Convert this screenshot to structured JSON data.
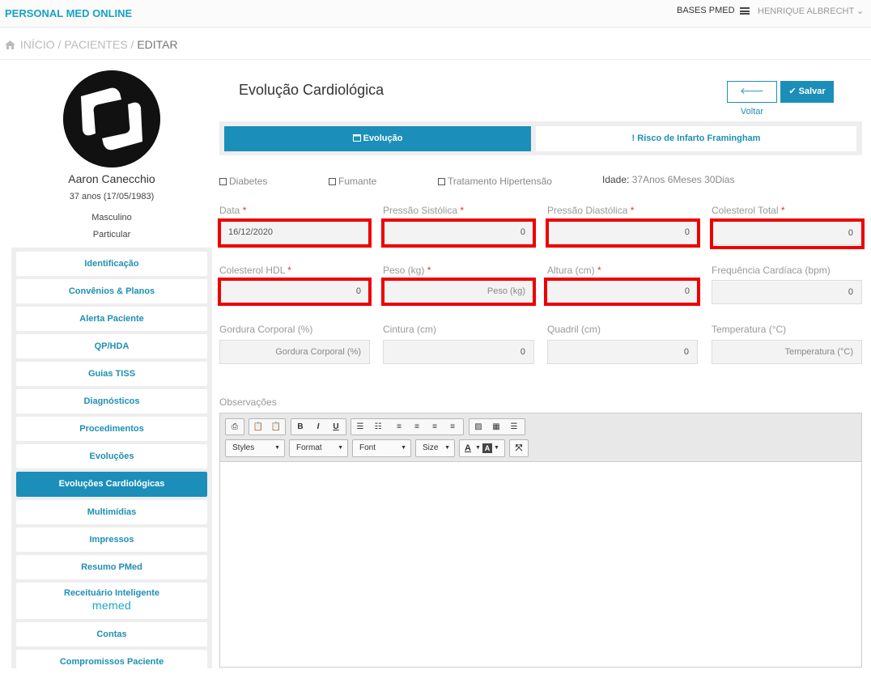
{
  "header": {
    "brand": "PERSONAL MED ONLINE",
    "bases": "BASES PMED",
    "user": "HENRIQUE ALBRECHT ⌄"
  },
  "breadcrumb": {
    "inicio": "INÍCIO",
    "sep1": " / ",
    "pacientes": "PACIENTES",
    "sep2": " / ",
    "editar": "EDITAR"
  },
  "patient": {
    "name": "Aaron Canecchio",
    "age": "37 anos (17/05/1983)",
    "sex": "Masculino",
    "plan": "Particular"
  },
  "sidebar": {
    "items": [
      {
        "label": "Identificação"
      },
      {
        "label": "Convênios & Planos"
      },
      {
        "label": "Alerta Paciente"
      },
      {
        "label": "QP/HDA"
      },
      {
        "label": "Guias TISS"
      },
      {
        "label": "Diagnósticos"
      },
      {
        "label": "Procedimentos"
      },
      {
        "label": "Evoluções"
      },
      {
        "label": "Evoluções Cardiológicas"
      },
      {
        "label": "Multimídias"
      },
      {
        "label": "Impressos"
      },
      {
        "label": "Resumo PMed"
      },
      {
        "label": "Receituário Inteligente",
        "sub": "memed"
      },
      {
        "label": "Contas"
      },
      {
        "label": "Compromissos Paciente"
      }
    ]
  },
  "main": {
    "title": "Evolução Cardiológica",
    "voltar": "Voltar",
    "salvar": "Salvar",
    "tabs": [
      {
        "label": "Evolução"
      },
      {
        "label": "Risco de Infarto Framingham"
      }
    ],
    "checks": {
      "diabetes": "Diabetes",
      "fumante": "Fumante",
      "hipertensao": "Tratamento Hipertensão"
    },
    "idade_label": "Idade:",
    "idade_value": "37Anos 6Meses 30Dias",
    "fields": {
      "data": {
        "label": "Data",
        "value": "16/12/2020"
      },
      "pas": {
        "label": "Pressão Sistólica",
        "value": "0"
      },
      "pad": {
        "label": "Pressão Diastólica",
        "value": "0"
      },
      "col_total": {
        "label": "Colesterol Total",
        "value": "0"
      },
      "col_hdl": {
        "label": "Colesterol HDL",
        "value": "0"
      },
      "peso": {
        "label": "Peso (kg)",
        "value": "Peso (kg)"
      },
      "altura": {
        "label": "Altura (cm)",
        "value": "0"
      },
      "fc": {
        "label": "Frequência Cardíaca (bpm)",
        "value": "0"
      },
      "gordura": {
        "label": "Gordura Corporal (%)",
        "value": "Gordura Corporal (%)"
      },
      "cintura": {
        "label": "Cintura (cm)",
        "value": "0"
      },
      "quadril": {
        "label": "Quadril (cm)",
        "value": "0"
      },
      "temperatura": {
        "label": "Temperatura (°C)",
        "value": "Temperatura (°C)"
      }
    },
    "required_mark": "*",
    "observacoes_label": "Observações",
    "editor": {
      "styles": "Styles",
      "format": "Format",
      "font": "Font",
      "size": "Size",
      "color_a": "A",
      "bg_a": "A"
    }
  }
}
